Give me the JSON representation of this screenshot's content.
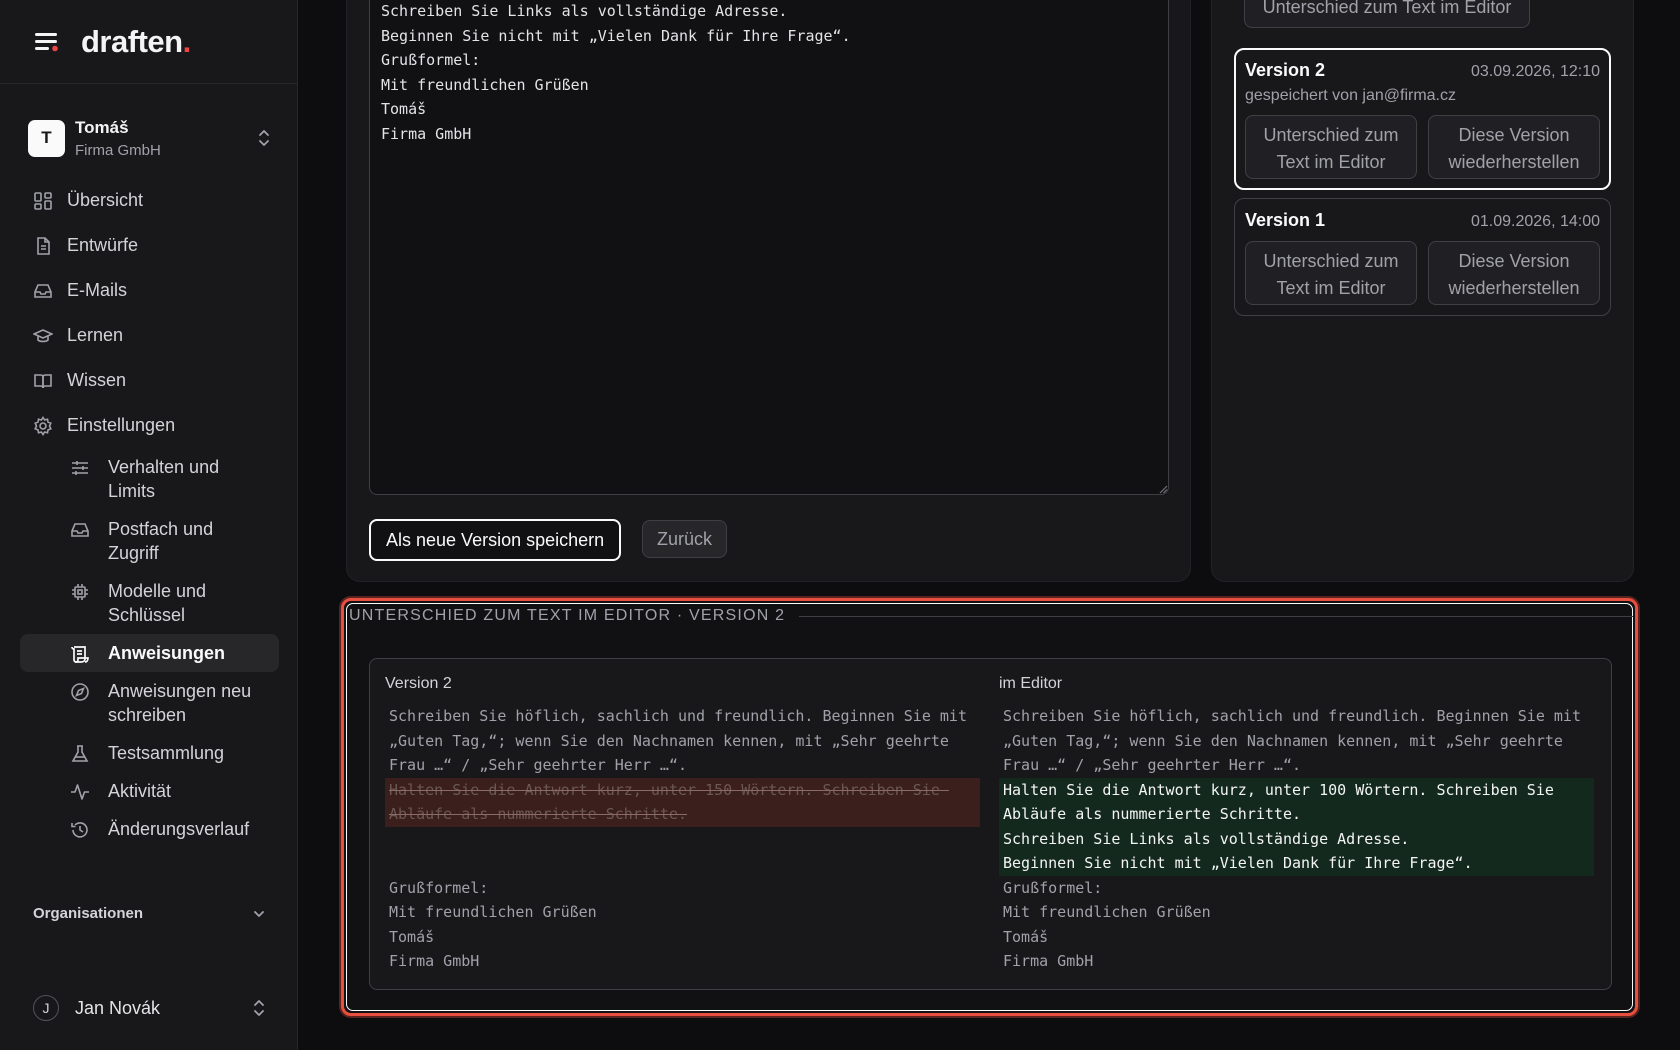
{
  "brand": {
    "name": "draften",
    "dot": "."
  },
  "workspace": {
    "initial": "T",
    "name": "Tomáš",
    "org": "Firma GmbH"
  },
  "nav": {
    "items": [
      {
        "label": "Übersicht",
        "icon": "grid-icon"
      },
      {
        "label": "Entwürfe",
        "icon": "document-icon"
      },
      {
        "label": "E-Mails",
        "icon": "inbox-icon"
      },
      {
        "label": "Lernen",
        "icon": "graduation-cap-icon"
      },
      {
        "label": "Wissen",
        "icon": "book-icon"
      },
      {
        "label": "Einstellungen",
        "icon": "gear-icon"
      }
    ],
    "settings_sub": [
      {
        "label": "Verhalten und Limits",
        "icon": "sliders-icon"
      },
      {
        "label": "Postfach und Zugriff",
        "icon": "inbox-icon"
      },
      {
        "label": "Modelle und Schlüssel",
        "icon": "chip-icon"
      },
      {
        "label": "Anweisungen",
        "icon": "scroll-icon",
        "active": true
      },
      {
        "label": "Anweisungen neu schreiben",
        "icon": "compass-icon"
      },
      {
        "label": "Testsammlung",
        "icon": "flask-icon"
      },
      {
        "label": "Aktivität",
        "icon": "activity-icon"
      },
      {
        "label": "Änderungsverlauf",
        "icon": "history-icon"
      }
    ],
    "organizations_label": "Organisationen"
  },
  "user": {
    "initial": "J",
    "name": "Jan Novák"
  },
  "editor": {
    "text": "Schreiben Sie Links als vollständige Adresse.\nBeginnen Sie nicht mit „Vielen Dank für Ihre Frage“.\nGrußformel:\nMit freundlichen Grüßen\nTomáš\nFirma GmbH",
    "save_button": "Als neue Version speichern",
    "back_button": "Zurück"
  },
  "versions": {
    "top_button": "Unterschied zum Text im Editor",
    "items": [
      {
        "title": "Version 2",
        "date": "03.09.2026, 12:10",
        "meta": "gespeichert von jan@firma.cz",
        "diff_button": "Unterschied zum Text im Editor",
        "restore_button": "Diese Version wiederherstellen"
      },
      {
        "title": "Version 1",
        "date": "01.09.2026, 14:00",
        "diff_button": "Unterschied zum Text im Editor",
        "restore_button": "Diese Version wiederherstellen"
      }
    ]
  },
  "diff": {
    "header": "UNTERSCHIED ZUM TEXT IM EDITOR · VERSION 2",
    "left_title": "Version 2",
    "right_title": "im Editor",
    "common_top": "Schreiben Sie höflich, sachlich und freundlich. Beginnen Sie mit „Guten Tag,“; wenn Sie den Nachnamen kennen, mit „Sehr geehrte Frau …“ / „Sehr geehrter Herr …“.",
    "removed": "Halten Sie die Antwort kurz, unter 150 Wörtern. Schreiben Sie Abläufe als nummerierte Schritte.",
    "added": "Halten Sie die Antwort kurz, unter 100 Wörtern. Schreiben Sie Abläufe als nummerierte Schritte.\nSchreiben Sie Links als vollständige Adresse.\nBeginnen Sie nicht mit „Vielen Dank für Ihre Frage“.",
    "common_bottom": "Grußformel:\nMit freundlichen Grüßen\nTomáš\nFirma GmbH"
  },
  "colors": {
    "accent": "#fafafa",
    "brand_dot": "#ef4444",
    "highlight_frame": "#e94f3e",
    "removed_bg": "#3a1f1c",
    "added_bg": "#13291e"
  }
}
